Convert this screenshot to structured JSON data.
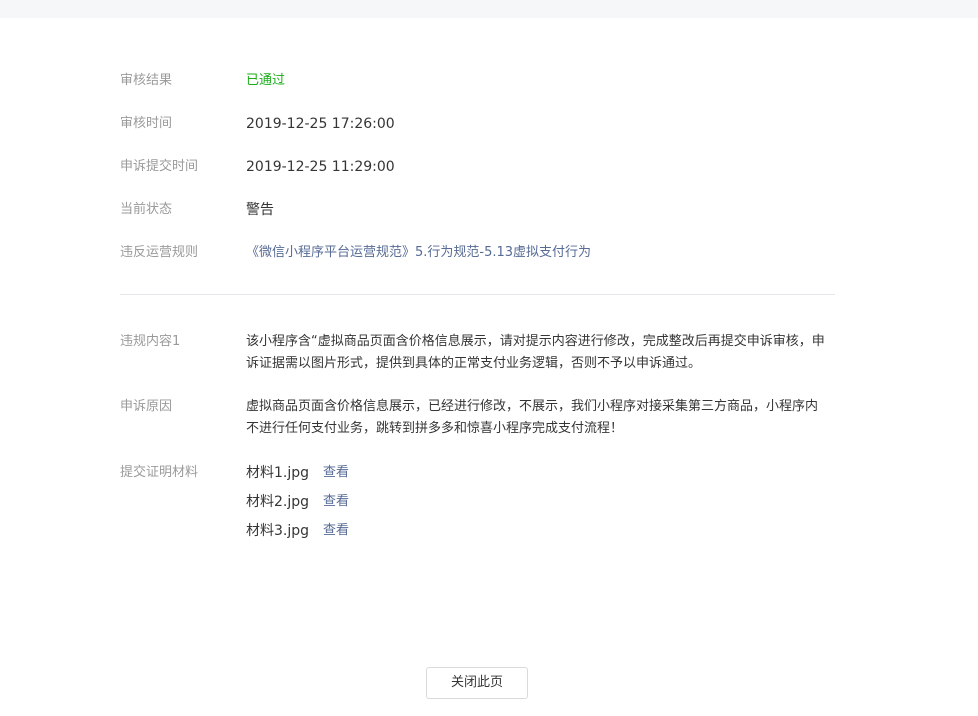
{
  "review": {
    "result_label": "审核结果",
    "result_value": "已通过",
    "time_label": "审核时间",
    "time_value": "2019-12-25 17:26:00",
    "submit_label": "申诉提交时间",
    "submit_value": "2019-12-25 11:29:00",
    "status_label": "当前状态",
    "status_value": "警告",
    "rule_label": "违反运营规则",
    "rule_value": "《微信小程序平台运营规范》5.行为规范-5.13虚拟支付行为"
  },
  "details": {
    "violation_label": "违规内容1",
    "violation_value": "该小程序含“虚拟商品页面含价格信息展示，请对提示内容进行修改，完成整改后再提交申诉审核，申诉证据需以图片形式，提供到具体的正常支付业务逻辑，否则不予以申诉通过。",
    "reason_label": "申诉原因",
    "reason_value": "虚拟商品页面含价格信息展示，已经进行修改，不展示，我们小程序对接采集第三方商品，小程序内 不进行任何支付业务，跳转到拼多多和惊喜小程序完成支付流程！",
    "materials_label": "提交证明材料",
    "materials": [
      {
        "name": "材料1.jpg",
        "action": "查看"
      },
      {
        "name": "材料2.jpg",
        "action": "查看"
      },
      {
        "name": "材料3.jpg",
        "action": "查看"
      }
    ]
  },
  "footer": {
    "close_label": "关闭此页"
  }
}
